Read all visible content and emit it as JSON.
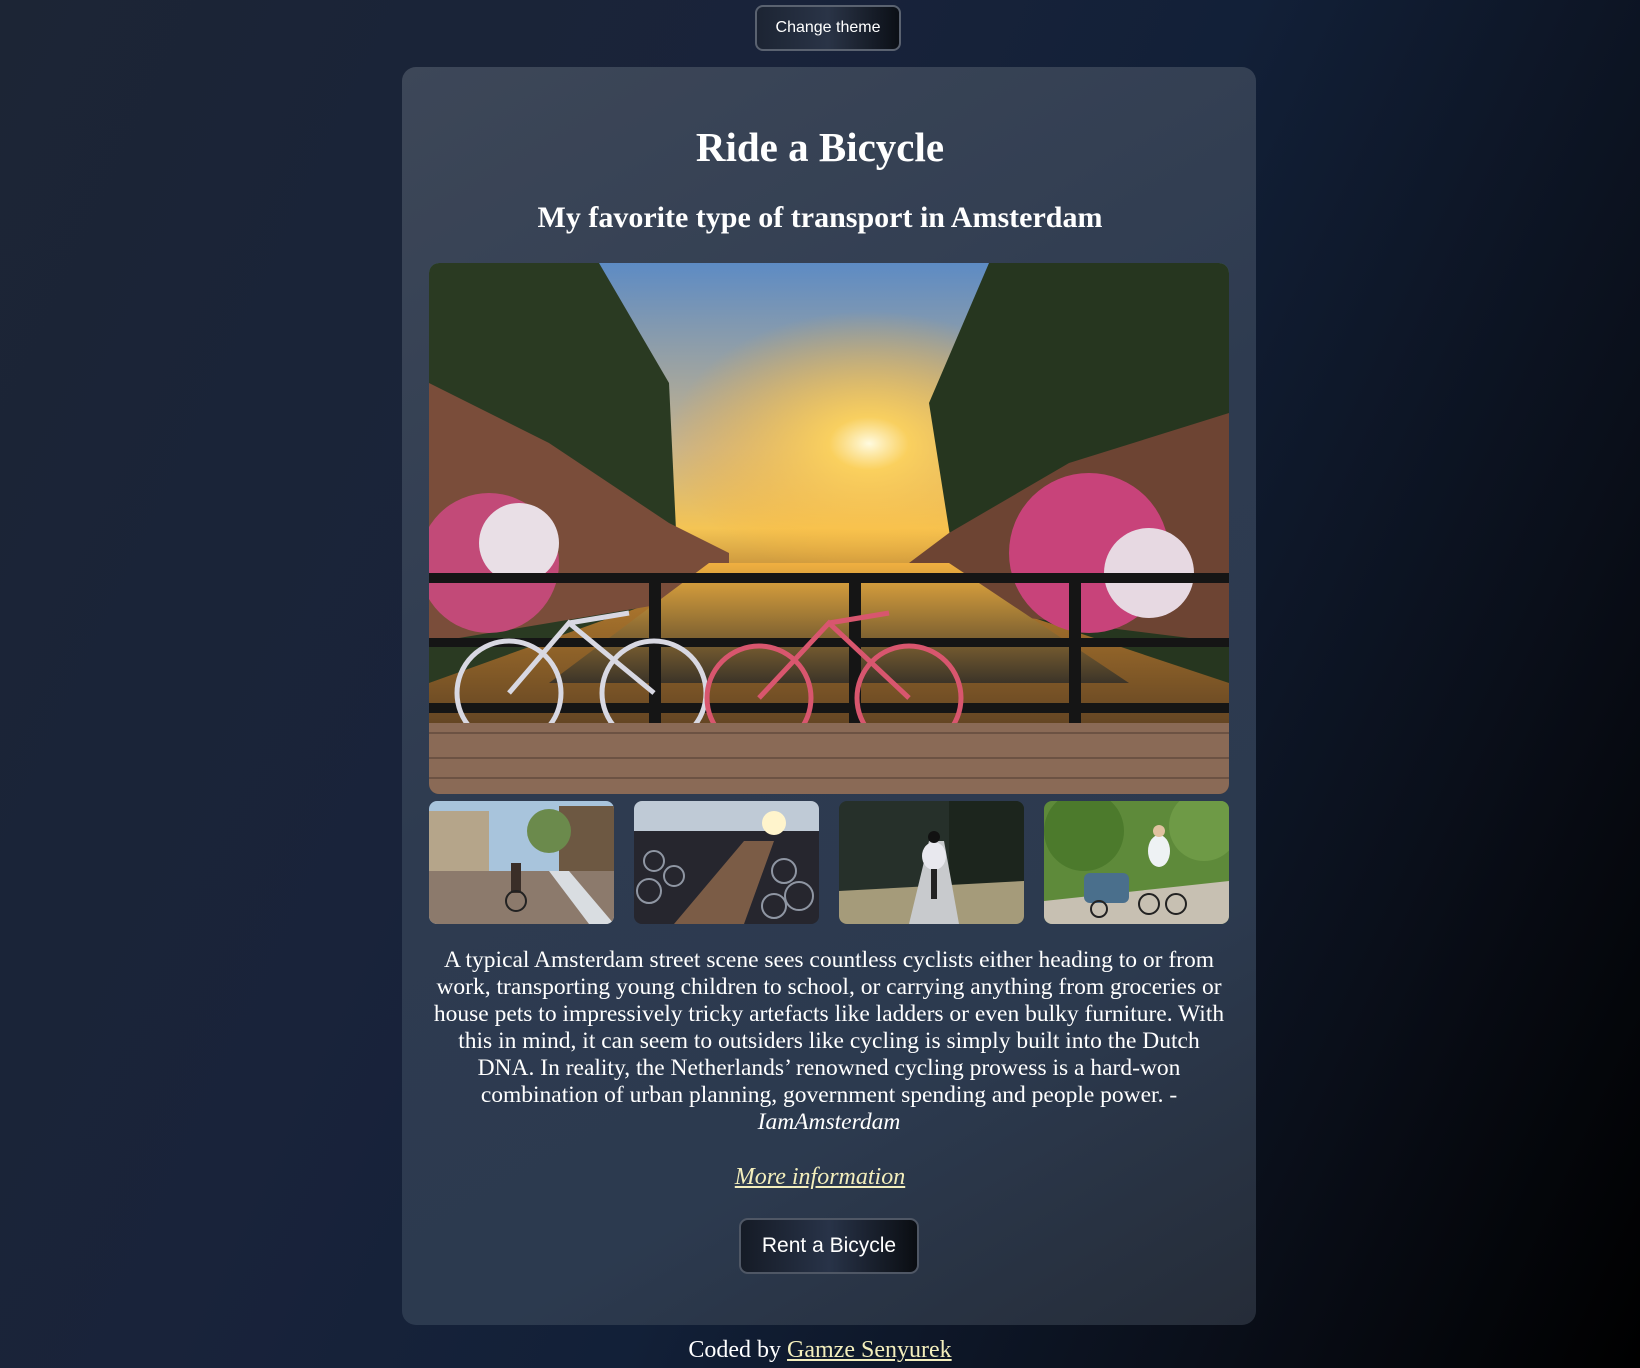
{
  "header": {
    "theme_button_label": "Change theme"
  },
  "main": {
    "title": "Ride a Bicycle",
    "subtitle": "My favorite type of transport in Amsterdam",
    "description": "A typical Amsterdam street scene sees countless cyclists either heading to or from work, transporting young children to school, or carrying anything from groceries or house pets to impressively tricky artefacts like ladders or even bulky furniture. With this in mind, it can seem to outsiders like cycling is simply built into the Dutch DNA. In reality, the Netherlands’ renowned cycling prowess is a hard-won combination of urban planning, government spending and people power. -",
    "description_source": "IamAmsterdam",
    "more_link_label": "More information",
    "rent_button_label": "Rent a Bicycle"
  },
  "footer": {
    "prefix": "Coded by",
    "author_link_label": "Gamze Senyurek"
  },
  "colors": {
    "link": "#f3eebc",
    "card": "#2e3b50",
    "background_dark": "#000000"
  }
}
